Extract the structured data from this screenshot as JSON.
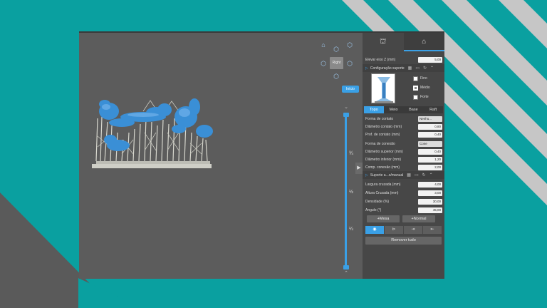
{
  "colors": {
    "background": "#0aa0a0",
    "accent": "#3aa0e6",
    "model": "#3a8fd6",
    "supports": "#cfcfc7"
  },
  "viewcube": {
    "right_label": "Right",
    "home_label": "Início"
  },
  "slider": {
    "tick_labels": [
      "¾",
      "½",
      "¼"
    ]
  },
  "panel": {
    "tabs": [
      {
        "icon": "support-tab-icon",
        "glyph": "⛫"
      },
      {
        "icon": "pillar-tab-icon",
        "glyph": "⌂"
      }
    ],
    "lift": {
      "label": "Elevar eixo Z (mm)",
      "value": "5,00"
    },
    "config_section": {
      "title": "Configuração suporte"
    },
    "density_options": [
      {
        "label": "Fino",
        "checked": false
      },
      {
        "label": "Médio",
        "checked": true
      },
      {
        "label": "Forte",
        "checked": false
      }
    ],
    "subtabs": [
      "Topo",
      "Meio",
      "Base",
      "Raft"
    ],
    "fields": [
      {
        "label": "Forma de contato",
        "value": "Nenhu...",
        "type": "select"
      },
      {
        "label": "Diâmetro contato (mm)",
        "value": "0,80",
        "type": "value"
      },
      {
        "label": "Prof. de contato (mm)",
        "value": "0,40",
        "type": "value"
      },
      {
        "label": "Forma de conexão",
        "value": "Cone",
        "type": "select"
      },
      {
        "label": "Diâmetro superior (mm)",
        "value": "0,40",
        "type": "value"
      },
      {
        "label": "Diâmetro inferior (mm)",
        "value": "1,20",
        "type": "value"
      },
      {
        "label": "Comp. conexão (mm)",
        "value": "2,00",
        "type": "value"
      }
    ],
    "manual_section": {
      "title": "Suporte a...o/manual"
    },
    "manual_fields": [
      {
        "label": "Largura cruzada (mm)",
        "value": "4,00"
      },
      {
        "label": "Altura Cruzada (mm)",
        "value": "3,00"
      },
      {
        "label": "Densidade (%)",
        "value": "30,00"
      },
      {
        "label": "Ângulo (°)",
        "value": "45,00"
      }
    ],
    "add_table_label": "+Mesa",
    "add_normal_label": "+Normal",
    "iconbar": [
      {
        "icon": "eye-icon",
        "glyph": "◉"
      },
      {
        "icon": "cursor-support-icon",
        "glyph": "⊳"
      },
      {
        "icon": "connect-support-icon",
        "glyph": "⇥"
      },
      {
        "icon": "edit-support-icon",
        "glyph": "⇤"
      }
    ],
    "remove_all_label": "Remover tudo"
  }
}
